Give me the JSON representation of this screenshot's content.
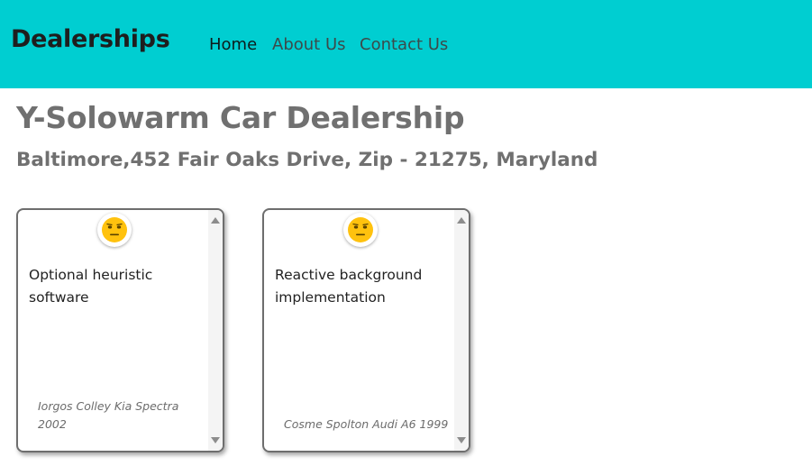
{
  "nav": {
    "brand": "Dealerships",
    "links": [
      "Home",
      "About Us",
      "Contact Us"
    ]
  },
  "dealer": {
    "name": "Y-Solowarm Car Dealership",
    "address": "Baltimore,452 Fair Oaks Drive, Zip - 21275, Maryland"
  },
  "reviews": [
    {
      "text": "Optional heuristic software",
      "car": "Iorgos Colley Kia Spectra 2002",
      "sentiment_icon": "neutral-face-icon"
    },
    {
      "text": "Reactive background implementation",
      "car": "Cosme Spolton Audi A6 1999",
      "sentiment_icon": "neutral-face-icon"
    }
  ],
  "colors": {
    "navbar": "#00ced1",
    "emoji": "#ffc20e"
  }
}
